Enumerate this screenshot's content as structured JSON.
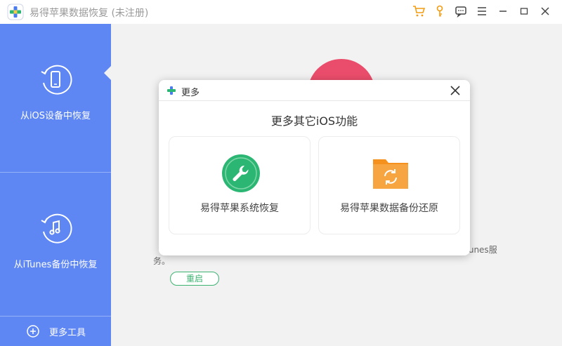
{
  "window": {
    "title": "易得苹果数据恢复 (未注册)",
    "icons": [
      "cart-icon",
      "key-icon",
      "feedback-icon",
      "menu-icon",
      "minimize-icon",
      "maximize-icon",
      "close-icon"
    ]
  },
  "sidebar": {
    "items": [
      {
        "label": "从iOS设备中恢复",
        "icon": "phone-restore-icon"
      },
      {
        "label": "从iTunes备份中恢复",
        "icon": "music-restore-icon"
      }
    ],
    "more_tools": "更多工具"
  },
  "main": {
    "partial_text_right": "iTunes服",
    "partial_text_line2": "务。",
    "restart_label": "重启"
  },
  "modal": {
    "title": "更多",
    "heading": "更多其它iOS功能",
    "cards": [
      {
        "label": "易得苹果系统恢复",
        "icon": "wrench-icon",
        "color": "#2bb673"
      },
      {
        "label": "易得苹果数据备份还原",
        "icon": "folder-sync-icon",
        "color": "#f5921e"
      }
    ]
  },
  "colors": {
    "sidebar": "#5f87f4",
    "accent_green": "#3cb371",
    "accent_orange": "#f5921e",
    "cart_orange": "#f39c12"
  }
}
